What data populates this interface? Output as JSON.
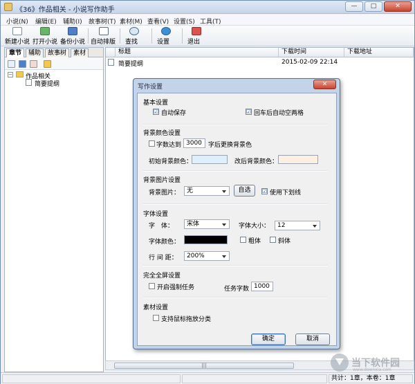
{
  "window": {
    "title": "《36》作品相关 - 小说写作助手",
    "controls": {
      "minimize": "—",
      "maximize": "□",
      "close": "✕"
    }
  },
  "menu": [
    "小说(N)",
    "编辑(E)",
    "辅助(I)",
    "故事树(T)",
    "素材(M)",
    "查看(V)",
    "设置(S)",
    "工具(T)"
  ],
  "toolbar": [
    "新建小说",
    "打开小说",
    "备份小说",
    "自动排版",
    "查找",
    "设置",
    "退出"
  ],
  "left": {
    "tabs": [
      "章节",
      "辅助",
      "故事树",
      "素材"
    ],
    "tree": {
      "root": "作品相关",
      "child": "简要提纲",
      "expander": "−"
    }
  },
  "list": {
    "columns": [
      "标题",
      "下载时间",
      "下载地址"
    ],
    "rows": [
      {
        "title": "简要提纲",
        "time": "2015-02-09 22:14",
        "url": ""
      }
    ]
  },
  "status": {
    "text": "共计：1章，本卷：1章"
  },
  "watermark": {
    "text": "当下软件园",
    "sub": "www.downxia.com"
  },
  "dialog": {
    "title": "写作设置",
    "close": "✕",
    "basic": {
      "title": "基本设置",
      "autosave": {
        "label": "自动保存",
        "checked": "☑"
      },
      "enter_indent": {
        "label": "回车后自动空两格",
        "checked": "☑"
      }
    },
    "bgcolor": {
      "title": "背景颜色设置",
      "count_prefix": "字数达到",
      "count_value": "3000",
      "count_suffix": "字后更换背景色",
      "initial_label": "初始背景颜色：",
      "initial_color": "#deeefa",
      "changed_label": "改后背景颜色：",
      "changed_color": "#fdf0e2"
    },
    "bgimage": {
      "title": "背景图片设置",
      "label": "背景图片：",
      "value": "无",
      "choose": "自选",
      "underline": {
        "label": "使用下划线",
        "checked": "☑"
      }
    },
    "font": {
      "title": "字体设置",
      "font_label": "字　体：",
      "font_value": "宋体",
      "size_label": "字体大小：",
      "size_value": "12",
      "color_label": "字体颜色：",
      "color": "#000000",
      "bold": "粗体",
      "italic": "斜体",
      "spacing_label": "行 间 距：",
      "spacing_value": "200%"
    },
    "fullscreen": {
      "title": "完全全屏设置",
      "force_task": "开启强制任务",
      "task_label": "任务字数",
      "task_value": "1000"
    },
    "material": {
      "title": "素材设置",
      "drag_sort": "支持鼠标拖放分类"
    },
    "ok": "确定",
    "cancel": "取消"
  }
}
